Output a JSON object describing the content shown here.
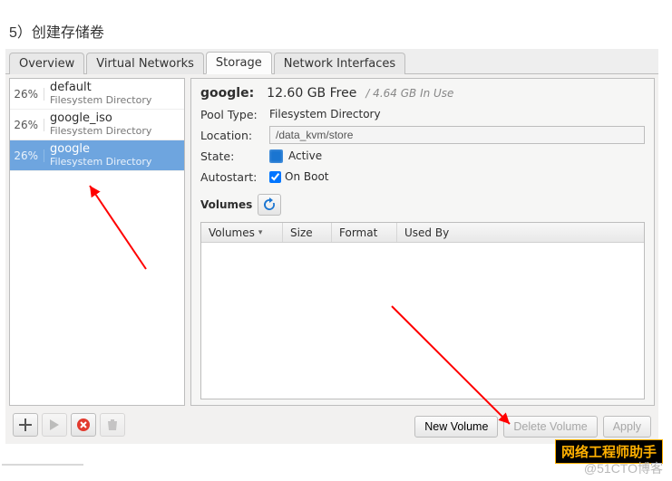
{
  "step_label": "5）创建存储卷",
  "tabs": {
    "overview": "Overview",
    "vnet": "Virtual Networks",
    "storage": "Storage",
    "nic": "Network Interfaces",
    "active": "storage"
  },
  "sidebar": {
    "items": [
      {
        "pct": "26%",
        "name": "default",
        "sub": "Filesystem Directory",
        "selected": false
      },
      {
        "pct": "26%",
        "name": "google_iso",
        "sub": "Filesystem Directory",
        "selected": false
      },
      {
        "pct": "26%",
        "name": "google",
        "sub": "Filesystem Directory",
        "selected": true
      }
    ]
  },
  "toolbar": {
    "add": "+",
    "play": "▶",
    "stop": "✖",
    "delete": "🗑"
  },
  "pool": {
    "name": "google:",
    "free": "12.60 GB Free",
    "inuse": "/ 4.64 GB In Use",
    "type_label": "Pool Type:",
    "type_value": "Filesystem Directory",
    "location_label": "Location:",
    "location_value": "/data_kvm/store",
    "state_label": "State:",
    "state_value": "Active",
    "autostart_label": "Autostart:",
    "autostart_value": "On Boot",
    "autostart_checked": true
  },
  "volumes": {
    "section_label": "Volumes",
    "columns": {
      "c1": "Volumes",
      "c2": "Size",
      "c3": "Format",
      "c4": "Used By"
    }
  },
  "buttons": {
    "new_volume": "New Volume",
    "delete_volume": "Delete Volume",
    "apply": "Apply"
  },
  "watermark_badge": "网络工程师助手",
  "watermark_text": "@51CTO博客"
}
